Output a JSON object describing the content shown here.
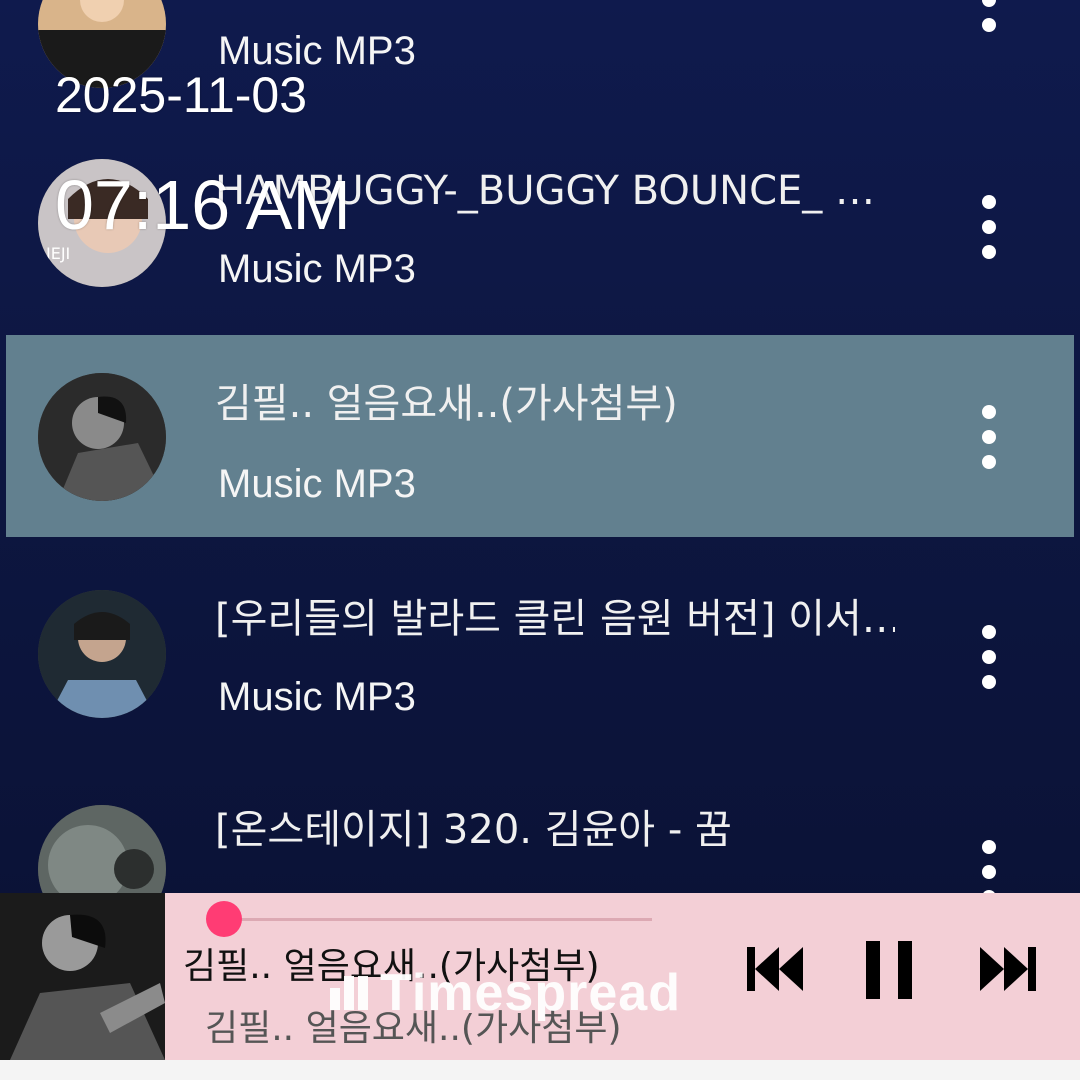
{
  "overlay": {
    "date": "2025-11-03",
    "time": "07:16 AM"
  },
  "list": {
    "items": [
      {
        "title": "",
        "subtitle": "Music MP3",
        "thumb_icon": "album-art-icon"
      },
      {
        "title": "HAMBUGGY-_BUGGY BOUNCE_ …",
        "subtitle": "Music MP3",
        "thumb_icon": "album-art-icon"
      },
      {
        "title": "김필.. 얼음요새..(가사첨부)",
        "subtitle": "Music MP3",
        "thumb_icon": "album-art-icon",
        "selected": true
      },
      {
        "title": "[우리들의 발라드 클린 음원 버전] 이서…",
        "subtitle": "Music MP3",
        "thumb_icon": "album-art-icon"
      },
      {
        "title": "[온스테이지] 320. 김윤아 - 꿈",
        "subtitle": "",
        "thumb_icon": "album-art-icon"
      }
    ],
    "menu_icon": "more-vertical-icon"
  },
  "player": {
    "title": "김필.. 얼음요새..(가사첨부)",
    "artist": "김필.. 얼음요새..(가사첨부)",
    "progress": 0.01,
    "controls": [
      "skip-previous-icon",
      "pause-icon",
      "skip-next-icon"
    ]
  },
  "watermark": {
    "text": "Timespread"
  },
  "colors": {
    "background": "#0d1640",
    "selected_row": "#62808f",
    "player_bg": "#f3cfd6",
    "accent": "#ff3c74"
  }
}
